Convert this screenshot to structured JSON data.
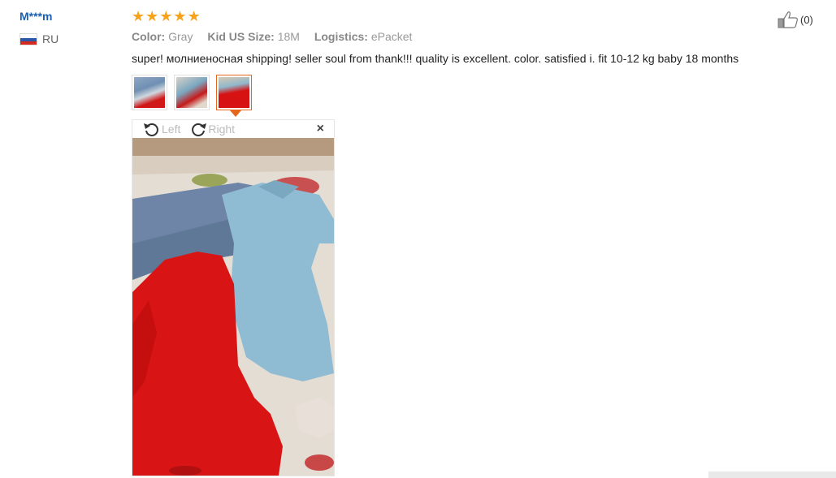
{
  "reviewer": {
    "name": "M***m",
    "country": "RU",
    "flag_icon": "russia-flag-icon"
  },
  "rating": {
    "stars": 5,
    "max": 5,
    "star_color": "#f7a21b"
  },
  "attributes": [
    {
      "label": "Color:",
      "value": "Gray"
    },
    {
      "label": "Kid US Size:",
      "value": "18M"
    },
    {
      "label": "Logistics:",
      "value": "ePacket"
    }
  ],
  "feedback_text": "super! молниеносная shipping! seller soul from thank!!! quality is excellent. color. satisfied i. fit 10-12 kg baby 18 months",
  "thumbnails": {
    "count": 3,
    "selected_index": 2
  },
  "viewer": {
    "rotate_left_label": "Left",
    "rotate_right_label": "Right",
    "close_label": "×"
  },
  "helpful": {
    "count_label": "(0)",
    "icon": "thumbs-up-icon"
  },
  "colors": {
    "accent": "#e5661d",
    "link": "#1a5fb4"
  }
}
